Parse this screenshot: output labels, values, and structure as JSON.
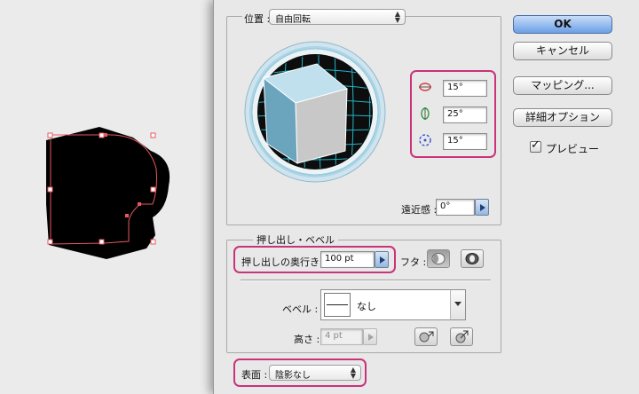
{
  "dialog": {
    "position_group": {
      "label": "位置 :",
      "preset": "自由回転",
      "rotation_x": "15°",
      "rotation_y": "25°",
      "rotation_z": "15°",
      "perspective_label": "遠近感 :",
      "perspective_value": "0°"
    },
    "extrude_group": {
      "title": "押し出し・ベベル",
      "depth_label": "押し出しの奥行き :",
      "depth_value": "100 pt",
      "cap_label": "フタ :",
      "bevel_label": "ベベル :",
      "bevel_value": "なし",
      "height_label": "高さ :",
      "height_value": "4 pt"
    },
    "surface": {
      "label": "表面 :",
      "value": "陰影なし"
    },
    "buttons": {
      "ok": "OK",
      "cancel": "キャンセル",
      "mapping": "マッピング...",
      "more_options": "詳細オプション"
    },
    "preview": {
      "label": "プレビュー",
      "checked": true
    }
  },
  "colors": {
    "highlight": "#c9337a",
    "cube_front": "#6ba4bd",
    "grid": "#1fb6c9",
    "default_button": "#6b9fe6",
    "selection_path": "#e8585f"
  }
}
